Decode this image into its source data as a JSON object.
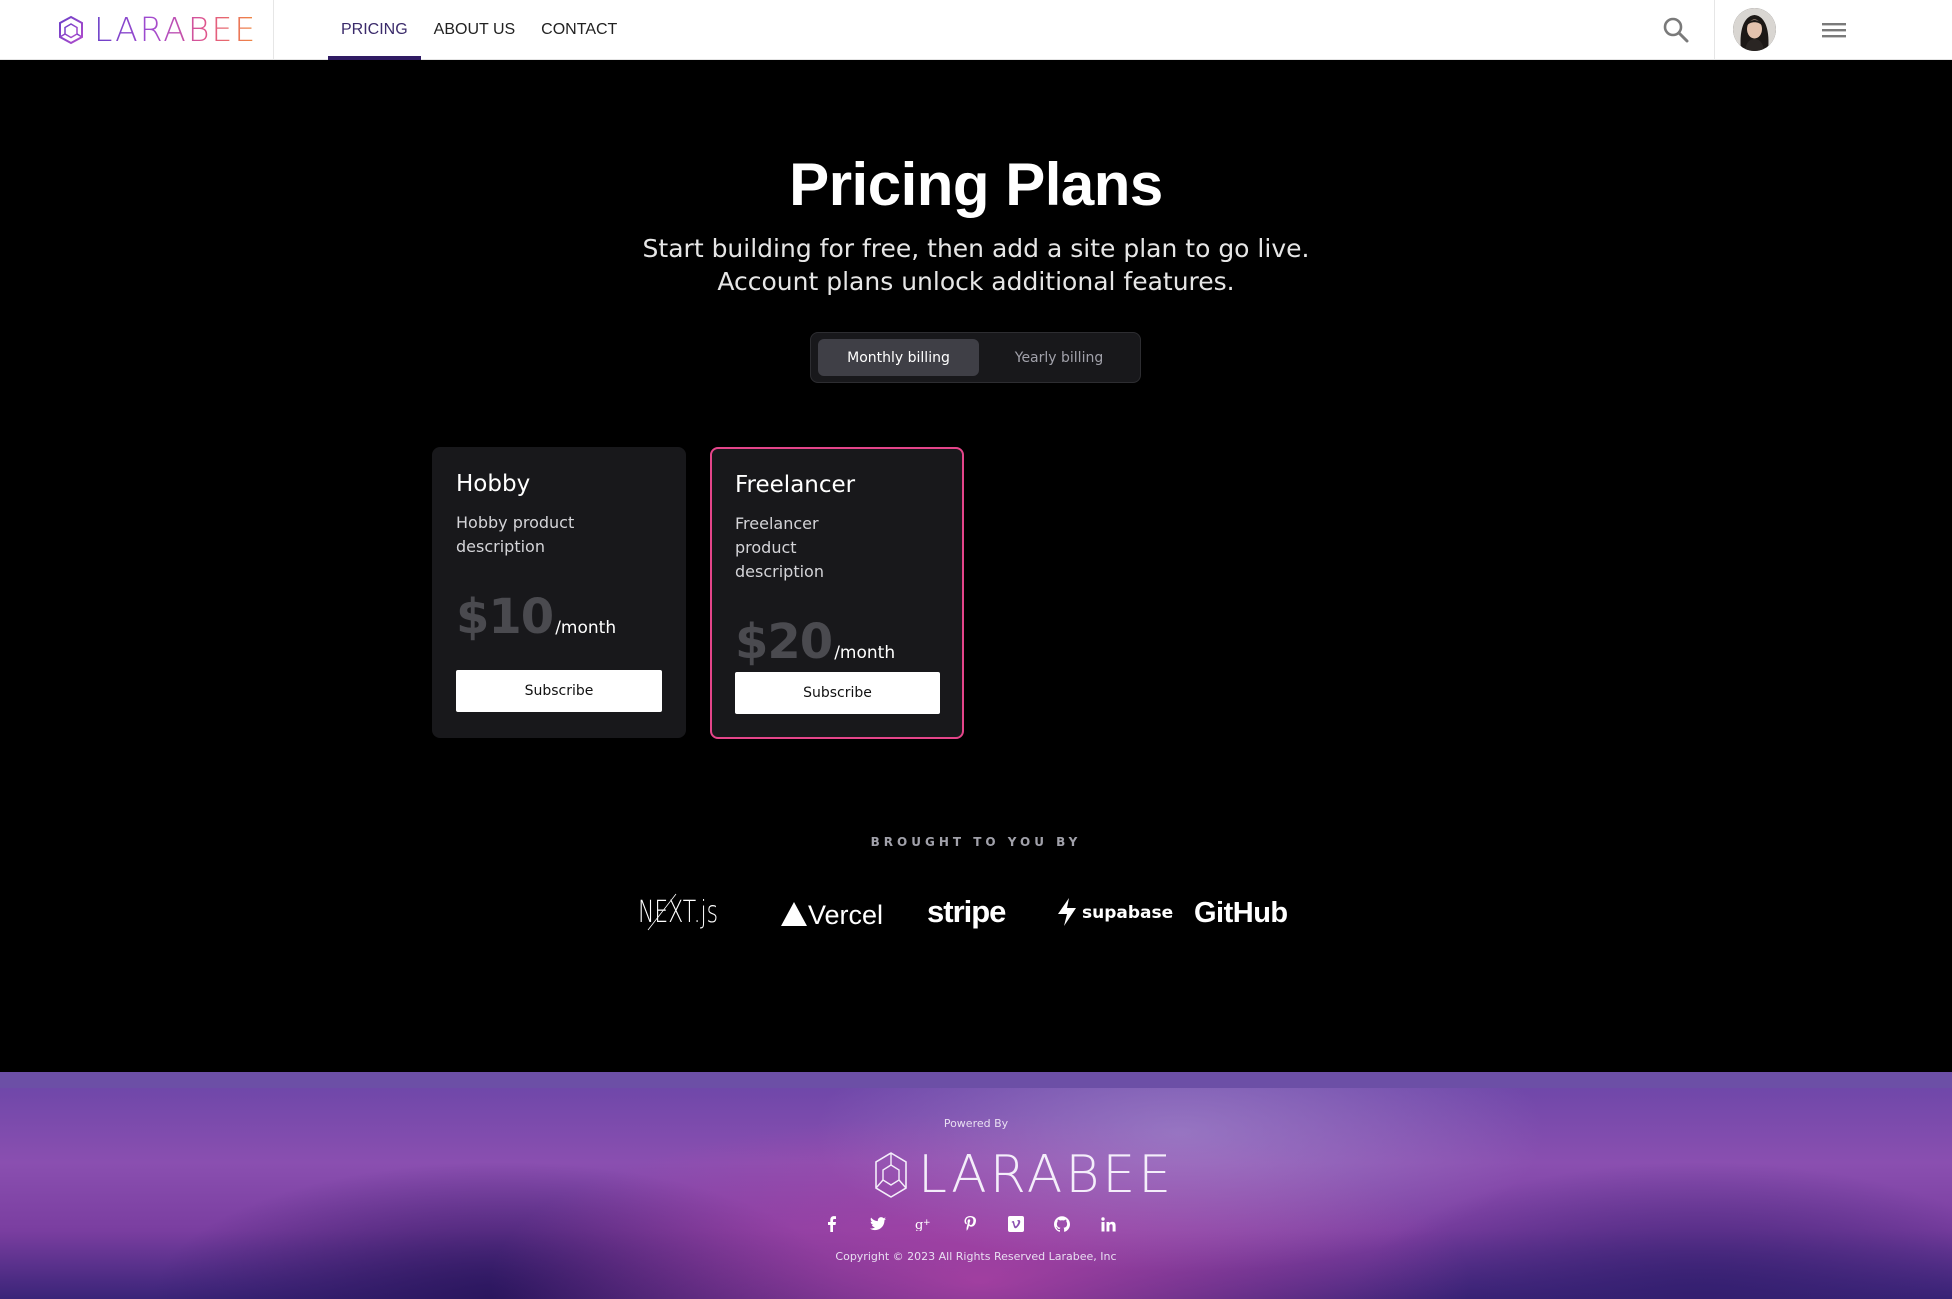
{
  "header": {
    "brand": "LARABEE",
    "nav": [
      {
        "label": "PRICING",
        "active": true
      },
      {
        "label": "ABOUT US",
        "active": false
      },
      {
        "label": "CONTACT",
        "active": false
      }
    ],
    "icons": {
      "search": "search-icon",
      "avatar": "user-avatar",
      "menu": "hamburger-menu-icon"
    },
    "accent_color": "#2f1b63"
  },
  "hero": {
    "title": "Pricing Plans",
    "subtitle_line1": "Start building for free, then add a site plan to go live.",
    "subtitle_line2": "Account plans unlock additional features."
  },
  "billing_toggle": {
    "monthly_label": "Monthly billing",
    "yearly_label": "Yearly billing",
    "selected": "Monthly billing"
  },
  "plans": [
    {
      "name": "Hobby",
      "description": "Hobby product description",
      "price": "$10",
      "period": "/month",
      "button": "Subscribe",
      "highlighted": false
    },
    {
      "name": "Freelancer",
      "description": "Freelancer product description",
      "price": "$20",
      "period": "/month",
      "button": "Subscribe",
      "highlighted": true,
      "highlight_color": "#e4458a"
    }
  ],
  "sponsors": {
    "heading": "BROUGHT TO YOU BY",
    "logos": [
      "NEXT.js",
      "Vercel",
      "stripe",
      "supabase",
      "GitHub"
    ]
  },
  "footer": {
    "powered_by": "Powered By",
    "brand": "LARABEE",
    "socials": [
      "facebook-icon",
      "twitter-icon",
      "google-plus-icon",
      "pinterest-icon",
      "vimeo-icon",
      "github-icon",
      "linkedin-icon"
    ],
    "copyright": "Copyright © 2023 All Rights Reserved Larabee, Inc"
  }
}
